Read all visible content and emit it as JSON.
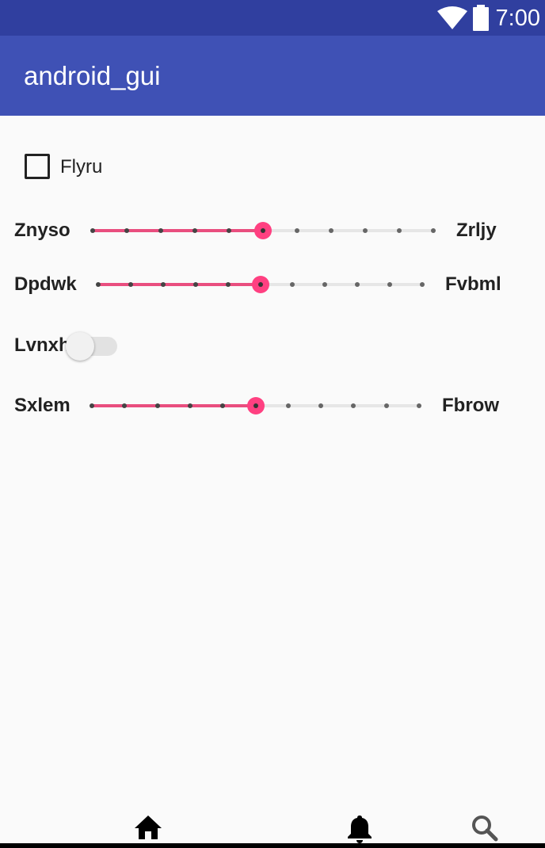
{
  "status_bar": {
    "time": "7:00",
    "icons": [
      "wifi-icon",
      "battery-icon"
    ]
  },
  "app_bar": {
    "title": "android_gui"
  },
  "checkbox": {
    "label": "Flyru",
    "checked": false
  },
  "sliders": [
    {
      "left_label": "Znyso",
      "right_label": "Zrljy",
      "value": 5,
      "max": 10
    },
    {
      "left_label": "Dpdwk",
      "right_label": "Fvbml",
      "value": 5,
      "max": 10
    },
    {
      "left_label": "Sxlem",
      "right_label": "Fbrow",
      "value": 5,
      "max": 10
    }
  ],
  "switch": {
    "label": "Lvnxh",
    "on": false
  },
  "bottom_nav": {
    "icons": [
      "home-icon",
      "bell-icon",
      "search-icon"
    ]
  },
  "colors": {
    "status_bar": "#303f9f",
    "app_bar": "#3f51b5",
    "accent": "#ff4081",
    "track_active": "#e94e7f",
    "background": "#fafafa"
  }
}
